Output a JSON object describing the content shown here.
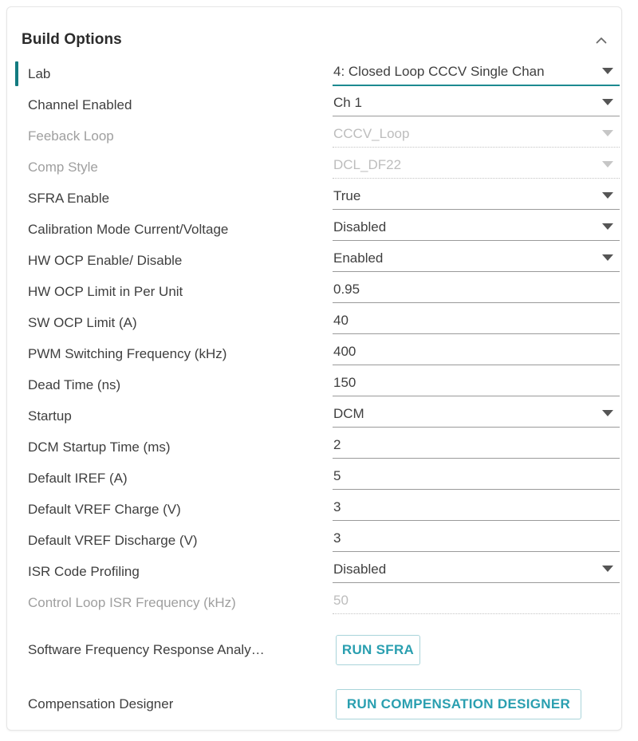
{
  "panel": {
    "title": "Build Options",
    "collapse_icon": "chevron-up-icon",
    "accent_color": "#137b80",
    "button_color": "#2a9fb0",
    "button_border_color": "#a9d4da"
  },
  "rows": [
    {
      "label": "Lab",
      "value": "4: Closed Loop CCCV Single Chan",
      "type": "dropdown",
      "state": "active"
    },
    {
      "label": "Channel Enabled",
      "value": "Ch 1",
      "type": "dropdown",
      "state": "normal"
    },
    {
      "label": "Feeback Loop",
      "value": "CCCV_Loop",
      "type": "dropdown",
      "state": "disabled"
    },
    {
      "label": "Comp Style",
      "value": "DCL_DF22",
      "type": "dropdown",
      "state": "disabled"
    },
    {
      "label": "SFRA Enable",
      "value": "True",
      "type": "dropdown",
      "state": "normal"
    },
    {
      "label": "Calibration Mode Current/Voltage",
      "value": "Disabled",
      "type": "dropdown",
      "state": "normal"
    },
    {
      "label": "HW OCP Enable/ Disable",
      "value": "Enabled",
      "type": "dropdown",
      "state": "normal"
    },
    {
      "label": "HW OCP Limit in Per Unit",
      "value": "0.95",
      "type": "text",
      "state": "normal"
    },
    {
      "label": "SW OCP Limit (A)",
      "value": "40",
      "type": "text",
      "state": "normal"
    },
    {
      "label": "PWM Switching Frequency (kHz)",
      "value": "400",
      "type": "text",
      "state": "normal"
    },
    {
      "label": "Dead Time (ns)",
      "value": "150",
      "type": "text",
      "state": "normal"
    },
    {
      "label": "Startup",
      "value": "DCM",
      "type": "dropdown",
      "state": "normal"
    },
    {
      "label": "DCM Startup Time (ms)",
      "value": "2",
      "type": "text",
      "state": "normal"
    },
    {
      "label": "Default IREF (A)",
      "value": "5",
      "type": "text",
      "state": "normal"
    },
    {
      "label": "Default VREF Charge (V)",
      "value": "3",
      "type": "text",
      "state": "normal"
    },
    {
      "label": "Default VREF Discharge (V)",
      "value": "3",
      "type": "text",
      "state": "normal"
    },
    {
      "label": "ISR Code Profiling",
      "value": "Disabled",
      "type": "dropdown",
      "state": "normal"
    },
    {
      "label": "Control Loop ISR Frequency (kHz)",
      "value": "50",
      "type": "text",
      "state": "disabled"
    }
  ],
  "actions": [
    {
      "label": "Software Frequency Response Analy…",
      "button": "RUN SFRA"
    },
    {
      "label": "Compensation Designer",
      "button": "RUN COMPENSATION DESIGNER"
    }
  ]
}
